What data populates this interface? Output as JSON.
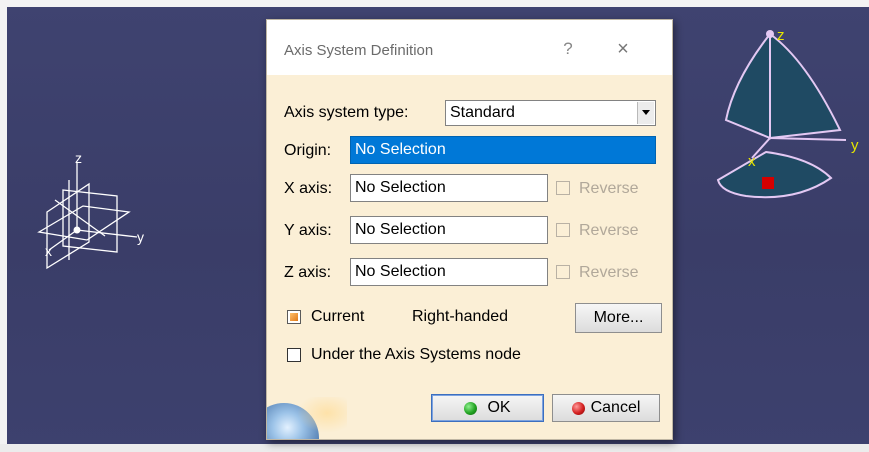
{
  "dialog": {
    "title": "Axis System Definition",
    "help": "?",
    "close": "×",
    "axis_type_label": "Axis system type:",
    "axis_type_value": "Standard",
    "origin_label": "Origin:",
    "origin_value": "No Selection",
    "x_axis_label": "X axis:",
    "x_axis_value": "No Selection",
    "y_axis_label": "Y axis:",
    "y_axis_value": "No Selection",
    "z_axis_label": "Z axis:",
    "z_axis_value": "No Selection",
    "reverse_label": "Reverse",
    "current_label": "Current",
    "handedness": "Right-handed",
    "more_button": "More...",
    "under_node_label": "Under the Axis Systems node",
    "ok_button": "OK",
    "cancel_button": "Cancel"
  },
  "viewport": {
    "left_axis": {
      "z": "z",
      "y": "y",
      "x": "x"
    },
    "compass": {
      "z": "z",
      "y": "y",
      "x": "x"
    }
  },
  "colors": {
    "viewport_bg": "#3c406c",
    "dialog_bg": "#fbefd6",
    "selection": "#0078d7",
    "compass_fill": "#1f4a63",
    "compass_line": "#e3c8f3",
    "axis_label": "#e6e600"
  }
}
